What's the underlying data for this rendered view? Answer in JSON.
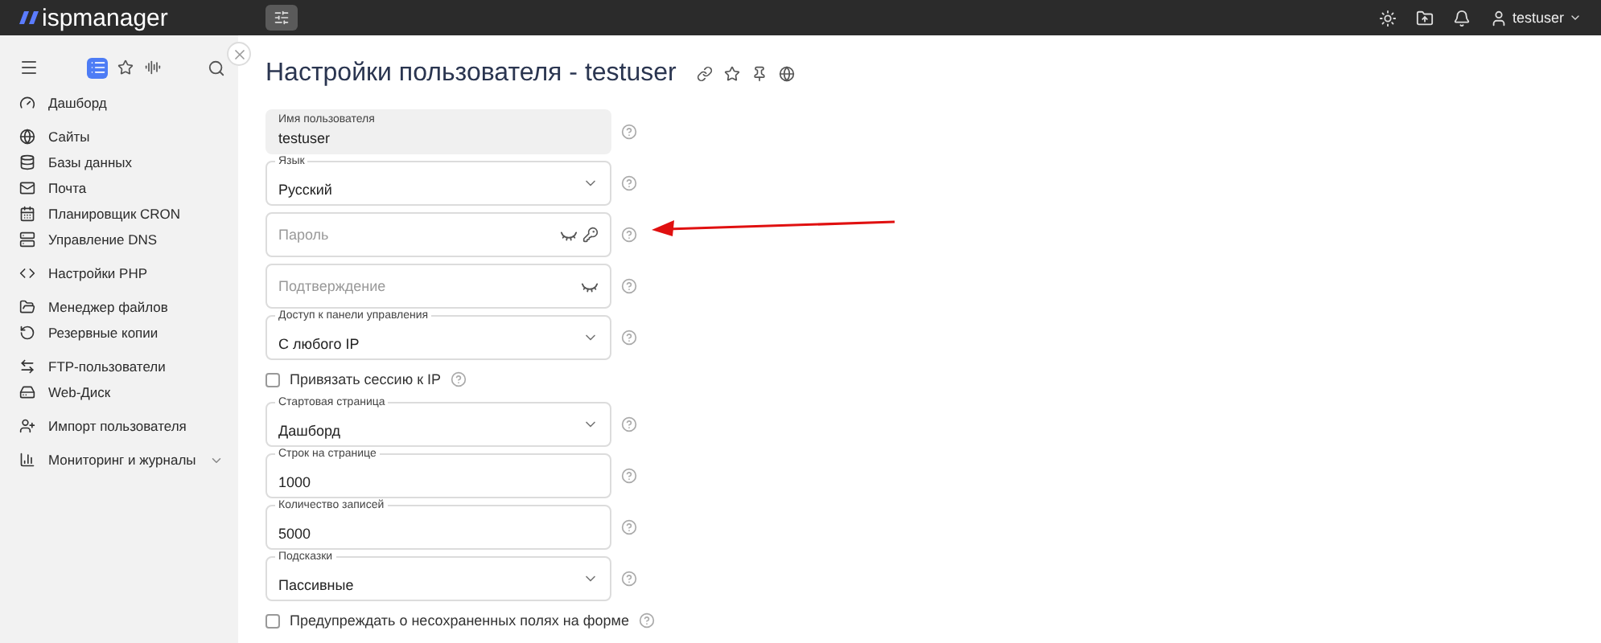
{
  "topbar": {
    "logo": "ispmanager",
    "user": "testuser"
  },
  "sidebar": {
    "tabs": [
      {
        "selected": true
      },
      {
        "selected": false
      },
      {
        "selected": false
      }
    ],
    "groups": [
      {
        "items": [
          {
            "label": "Дашборд"
          }
        ]
      },
      {
        "items": [
          {
            "label": "Сайты"
          },
          {
            "label": "Базы данных"
          },
          {
            "label": "Почта"
          },
          {
            "label": "Планировщик CRON"
          },
          {
            "label": "Управление DNS"
          }
        ]
      },
      {
        "items": [
          {
            "label": "Настройки PHP"
          }
        ]
      },
      {
        "items": [
          {
            "label": "Менеджер файлов"
          },
          {
            "label": "Резервные копии"
          }
        ]
      },
      {
        "items": [
          {
            "label": "FTP-пользователи"
          },
          {
            "label": "Web-Диск"
          }
        ]
      },
      {
        "items": [
          {
            "label": "Импорт пользователя"
          }
        ]
      },
      {
        "items": [
          {
            "label": "Мониторинг и журналы",
            "expanded": false
          }
        ]
      }
    ]
  },
  "page": {
    "title": "Настройки пользователя - testuser"
  },
  "form": [
    {
      "kind": "readonly",
      "label": "Имя пользователя",
      "value": "testuser"
    },
    {
      "kind": "select",
      "label": "Язык",
      "value": "Русский"
    },
    {
      "kind": "password",
      "placeholder": "Пароль",
      "generator": true
    },
    {
      "kind": "password",
      "placeholder": "Подтверждение",
      "generator": false
    },
    {
      "kind": "select",
      "label": "Доступ к панели управления",
      "value": "С любого IP"
    },
    {
      "kind": "checkbox",
      "label": "Привязать сессию к IP",
      "checked": false
    },
    {
      "kind": "select",
      "label": "Стартовая страница",
      "value": "Дашборд"
    },
    {
      "kind": "text",
      "label": "Строк на странице",
      "value": "1000"
    },
    {
      "kind": "text",
      "label": "Количество записей",
      "value": "5000"
    },
    {
      "kind": "select",
      "label": "Подсказки",
      "value": "Пассивные"
    },
    {
      "kind": "checkbox",
      "label": "Предупреждать о несохраненных полях на форме",
      "checked": false
    }
  ]
}
